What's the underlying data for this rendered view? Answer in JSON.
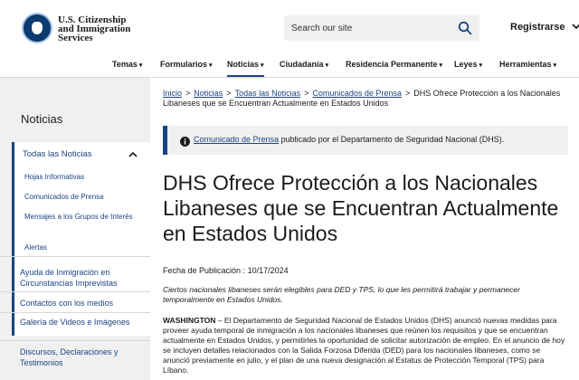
{
  "header": {
    "brand_line1": "U.S. Citizenship",
    "brand_line2": "and Immigration",
    "brand_line3": "Services",
    "search_placeholder": "Search our site",
    "language_button": "Registrarse"
  },
  "nav": {
    "items": [
      {
        "label": "Temas"
      },
      {
        "label": "Formularios"
      },
      {
        "label": "Noticias"
      },
      {
        "label": "Ciudadanía"
      },
      {
        "label": "Residencia Permanente"
      },
      {
        "label": "Leyes"
      },
      {
        "label": "Herramientas"
      }
    ]
  },
  "sidebar": {
    "title": "Noticias",
    "main_item": "Todas las Noticias",
    "sub_items": [
      "Hojas Informativas",
      "Comunicados de Prensa",
      "Mensajes a los Grupos de Interés",
      "Alertas"
    ],
    "other_items": [
      "Ayuda de Inmigración en Circunstancias Imprevistas",
      "Contactos con los medios",
      "Galería de Videos e Imágenes",
      "Discursos, Declaraciones y Testimonios"
    ]
  },
  "breadcrumb": {
    "items": [
      "Inicio",
      "Noticias",
      "Todas las Noticias",
      "Comunicados de Prensa"
    ],
    "current": "DHS Ofrece Protección a los Nacionales Libaneses que se Encuentran Actualmente en Estados Unidos"
  },
  "alert": {
    "link": "Comunicado de Prensa",
    "text": " publicado por el Departamento de Seguridad Nacional (DHS)."
  },
  "article": {
    "title": "DHS Ofrece Protección a los Nacionales Libaneses que se Encuentran Actualmente en Estados Unidos",
    "pub_label": "Fecha de Publicación :",
    "pub_date": "10/17/2024",
    "summary": "Ciertos nacionales libaneses serán elegibles para DED y TPS, lo que les permitirá trabajar y permanecer temporalmente en Estados Unidos.",
    "dateline": "WASHINGTON",
    "body": " – El Departamento de Seguridad Nacional de Estados Unidos (DHS) anunció nuevas medidas para proveer ayuda temporal de inmigración a los nacionales libaneses que reúnen los requisitos y que se encuentran actualmente en Estados Unidos, y permitirles la oportunidad de solicitar autorización de empleo. En el anuncio de hoy se incluyen detalles relacionados con la Salida Forzosa Diferida (DED) para los nacionales libaneses, como se anunció previamente en julio, y el plan de una nueva designación al Estatus de Protección Temporal (TPS) para Líbano."
  },
  "colors": {
    "accent": "#1a4480",
    "sidebar_bg": "#f0f0f0"
  }
}
